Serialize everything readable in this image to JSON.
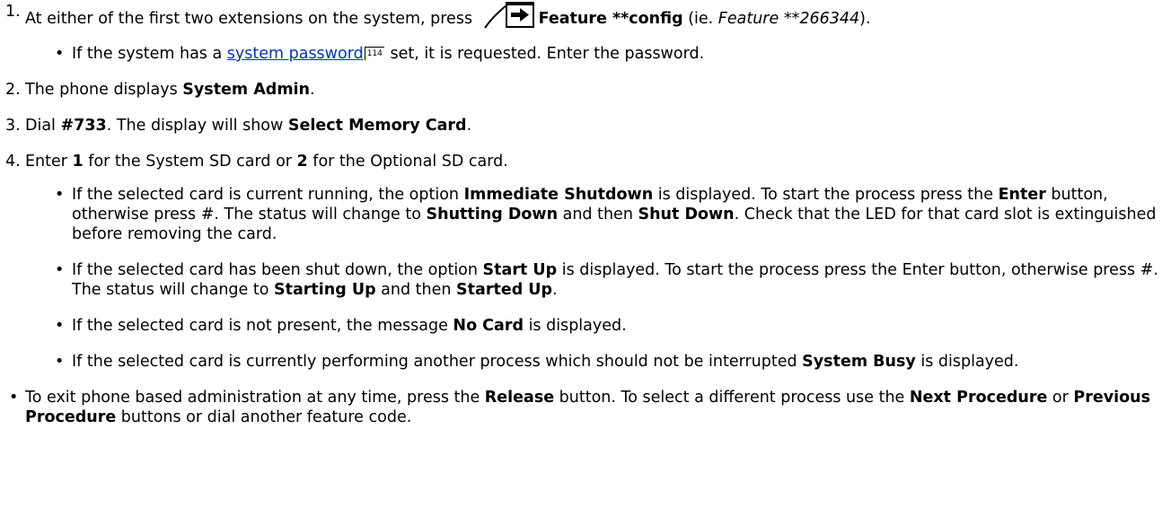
{
  "steps": [
    {
      "num": "1.",
      "a": "At either of the first two extensions on the system, press ",
      "icon": "feature-arrow-icon",
      "b_bold": "Feature **config",
      "c": " (ie. ",
      "d_italic": "Feature **266344",
      "e": ").",
      "sub": [
        {
          "a": "If the system has a ",
          "link": "system password",
          "ref": "114",
          "b": " set, it is requested. Enter the password."
        }
      ]
    },
    {
      "num": "2.",
      "a": "The phone displays ",
      "b_bold": "System Admin",
      "c": "."
    },
    {
      "num": "3.",
      "a": "Dial ",
      "b_bold": "#733",
      "c": ". The display will show ",
      "d_bold": "Select Memory Card",
      "e": "."
    },
    {
      "num": "4.",
      "a": "Enter ",
      "b_bold": "1",
      "c": " for the System SD card or ",
      "d_bold": "2",
      "e": " for the Optional SD card.",
      "sub": [
        {
          "a": "If the selected card is current running, the option ",
          "b_bold": "Immediate Shutdown",
          "c": " is displayed. To start the process press the ",
          "d_bold": "Enter",
          "e": " button, otherwise press #. The status will change to ",
          "f_bold": "Shutting Down",
          "g": " and then ",
          "h_bold": "Shut Down",
          "i": ". Check that the LED for that card slot is extinguished before removing the card."
        },
        {
          "a": "If the selected card has been shut down, the option ",
          "b_bold": "Start Up",
          "c": " is displayed. To start the process press the Enter button, otherwise press #. The status will change to ",
          "d_bold": "Starting Up",
          "e": " and then ",
          "f_bold": "Started Up",
          "g": "."
        },
        {
          "a": "If the selected card is not present, the message ",
          "b_bold": "No Card",
          "c": " is displayed."
        },
        {
          "a": "If the selected card is currently performing another process which should not be interrupted ",
          "b_bold": "System Busy",
          "c": " is displayed."
        }
      ]
    }
  ],
  "final_bullet": {
    "a": "To exit phone based administration at any time, press the ",
    "b_bold": "Release",
    "c": " button. To select a different process use the ",
    "d_bold": "Next Procedure",
    "e": " or ",
    "f_bold": "Previous Procedure",
    "g": " buttons or dial another feature code."
  },
  "bullet_char": "•"
}
